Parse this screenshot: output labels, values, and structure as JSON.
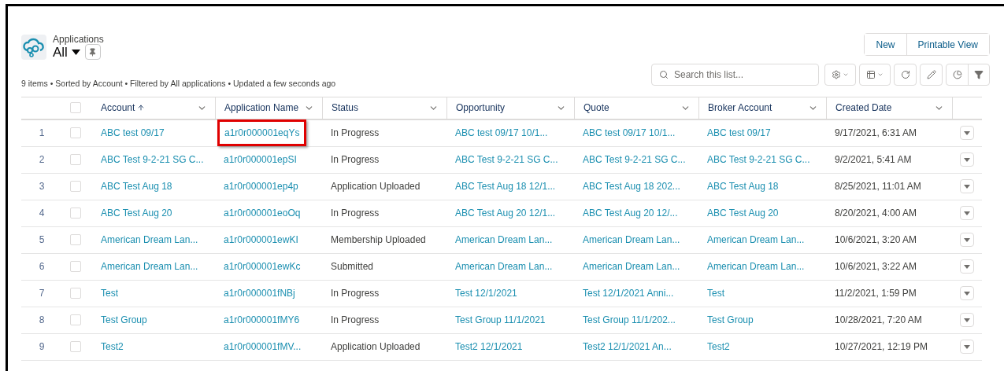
{
  "header": {
    "object_label": "Applications",
    "list_view": "All",
    "pinned": false
  },
  "summary": "9 items • Sorted by Account • Filtered by All applications • Updated a few seconds ago",
  "buttons": [
    "New",
    "Printable View"
  ],
  "search": {
    "placeholder": "Search this list..."
  },
  "all_checked": false,
  "columns": [
    {
      "label": "Account",
      "sorted": true
    },
    {
      "label": "Application Name",
      "sorted": false
    },
    {
      "label": "Status",
      "sorted": false
    },
    {
      "label": "Opportunity",
      "sorted": false
    },
    {
      "label": "Quote",
      "sorted": false
    },
    {
      "label": "Broker Account",
      "sorted": false
    },
    {
      "label": "Created Date",
      "sorted": false
    }
  ],
  "rows": [
    {
      "number": "1",
      "account": "ABC test 09/17",
      "application_name": "a1r0r000001eqYs",
      "highlighted": true,
      "checked": false,
      "status": "In Progress",
      "opportunity": "ABC test 09/17 10/1...",
      "quote": "ABC test 09/17 10/1...",
      "broker_account": "ABC test 09/17",
      "created_date": "9/17/2021, 6:31 AM"
    },
    {
      "number": "2",
      "account": "ABC Test 9-2-21 SG C...",
      "application_name": "a1r0r000001epSI",
      "highlighted": false,
      "checked": false,
      "status": "In Progress",
      "opportunity": "ABC Test 9-2-21 SG C...",
      "quote": "ABC Test 9-2-21 SG C...",
      "broker_account": "ABC Test 9-2-21 SG C...",
      "created_date": "9/2/2021, 5:41 AM"
    },
    {
      "number": "3",
      "account": "ABC Test Aug 18",
      "application_name": "a1r0r000001ep4p",
      "highlighted": false,
      "checked": false,
      "status": "Application Uploaded",
      "opportunity": "ABC Test Aug 18 12/1...",
      "quote": "ABC Test Aug 18 202...",
      "broker_account": "ABC Test Aug 18",
      "created_date": "8/25/2021, 11:01 AM"
    },
    {
      "number": "4",
      "account": "ABC Test Aug 20",
      "application_name": "a1r0r000001eoOq",
      "highlighted": false,
      "checked": false,
      "status": "In Progress",
      "opportunity": "ABC Test Aug 20 12/1...",
      "quote": "ABC Test Aug 20 12/...",
      "broker_account": "ABC Test Aug 20",
      "created_date": "8/20/2021, 4:00 AM"
    },
    {
      "number": "5",
      "account": "American Dream Lan...",
      "application_name": "a1r0r000001ewKI",
      "highlighted": false,
      "checked": false,
      "status": "Membership Uploaded",
      "opportunity": "American Dream Lan...",
      "quote": "American Dream Lan...",
      "broker_account": "American Dream Lan...",
      "created_date": "10/6/2021, 3:20 AM"
    },
    {
      "number": "6",
      "account": "American Dream Lan...",
      "application_name": "a1r0r000001ewKc",
      "highlighted": false,
      "checked": false,
      "status": "Submitted",
      "opportunity": "American Dream Lan...",
      "quote": "American Dream Lan...",
      "broker_account": "American Dream Lan...",
      "created_date": "10/6/2021, 3:22 AM"
    },
    {
      "number": "7",
      "account": "Test",
      "application_name": "a1r0r000001fNBj",
      "highlighted": false,
      "checked": false,
      "status": "In Progress",
      "opportunity": "Test 12/1/2021",
      "quote": "Test 12/1/2021 Anni...",
      "broker_account": "Test",
      "created_date": "11/2/2021, 1:59 PM"
    },
    {
      "number": "8",
      "account": "Test Group",
      "application_name": "a1r0r000001fMY6",
      "highlighted": false,
      "checked": false,
      "status": "In Progress",
      "opportunity": "Test Group 11/1/2021",
      "quote": "Test Group 11/1/202...",
      "broker_account": "Test Group",
      "created_date": "10/28/2021, 7:20 AM"
    },
    {
      "number": "9",
      "account": "Test2",
      "application_name": "a1r0r000001fMV...",
      "highlighted": false,
      "checked": false,
      "status": "Application Uploaded",
      "opportunity": "Test2 12/1/2021",
      "quote": "Test2 12/1/2021 An...",
      "broker_account": "Test2",
      "created_date": "10/27/2021, 12:19 PM"
    }
  ]
}
